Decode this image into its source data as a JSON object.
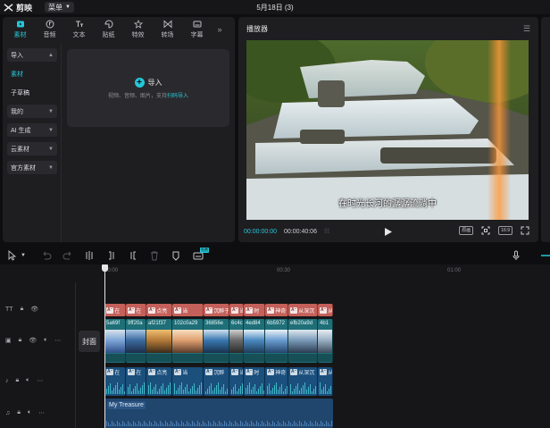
{
  "titlebar": {
    "app_name": "剪映",
    "menu_label": "菜单",
    "doc_title": "5月18日 (3)"
  },
  "media_tabs": [
    {
      "label": "素材",
      "icon": "media-icon",
      "active": true
    },
    {
      "label": "音频",
      "icon": "audio-icon",
      "active": false
    },
    {
      "label": "文本",
      "icon": "text-icon",
      "active": false
    },
    {
      "label": "贴纸",
      "icon": "sticker-icon",
      "active": false
    },
    {
      "label": "特效",
      "icon": "effects-icon",
      "active": false
    },
    {
      "label": "转场",
      "icon": "transition-icon",
      "active": false
    },
    {
      "label": "字幕",
      "icon": "caption-icon",
      "active": false
    }
  ],
  "side_nav": {
    "import": "导入",
    "material": "素材",
    "subtitle_draft": "子草稿",
    "mine": "我的",
    "ai_gen": "AI 生成",
    "cloud": "云素材",
    "official": "官方素材"
  },
  "import_area": {
    "label": "导入",
    "hint": "视频、音频、图片，支持",
    "hint_link": "扫码导入"
  },
  "player": {
    "title": "播放器",
    "subtitle": "在时光长河的潺潺流淌中",
    "current_time": "00:00:00:00",
    "duration": "00:00:40:06",
    "quality_label": "原画",
    "ratio_label": "16:9"
  },
  "timeline": {
    "ruler_ticks": [
      "00:00",
      "00:30",
      "01:00"
    ],
    "cover_label": "封面",
    "toolbar_badge": "免费",
    "text_clips": [
      {
        "text": "在"
      },
      {
        "text": "在"
      },
      {
        "text": "点亮"
      },
      {
        "text": "当"
      },
      {
        "text": "沉醉于"
      },
      {
        "text": "当"
      },
      {
        "text": "时"
      },
      {
        "text": "神奇"
      },
      {
        "text": "从深沉"
      },
      {
        "text": "从"
      }
    ],
    "video_clips": [
      {
        "name": "5a69f"
      },
      {
        "name": "9ff20a"
      },
      {
        "name": "af21f37"
      },
      {
        "name": "102c0a29"
      },
      {
        "name": "36856e"
      },
      {
        "name": "6c4c"
      },
      {
        "name": "4ed84"
      },
      {
        "name": "6b5972"
      },
      {
        "name": "efb20a9d"
      },
      {
        "name": "4b1"
      }
    ],
    "audio_clips": [
      {
        "text": "在"
      },
      {
        "text": "在"
      },
      {
        "text": "点亮"
      },
      {
        "text": "当"
      },
      {
        "text": "沉醉"
      },
      {
        "text": "当"
      },
      {
        "text": "时"
      },
      {
        "text": "神奇"
      },
      {
        "text": "从深沉"
      },
      {
        "text": "从"
      }
    ],
    "music_label": "My Treasure"
  },
  "colors": {
    "accent": "#25c7d8",
    "text_clip": "#c4605a",
    "video_clip": "#1f6f78",
    "audio_clip": "#1b4f7c",
    "music_clip": "#21466e"
  }
}
